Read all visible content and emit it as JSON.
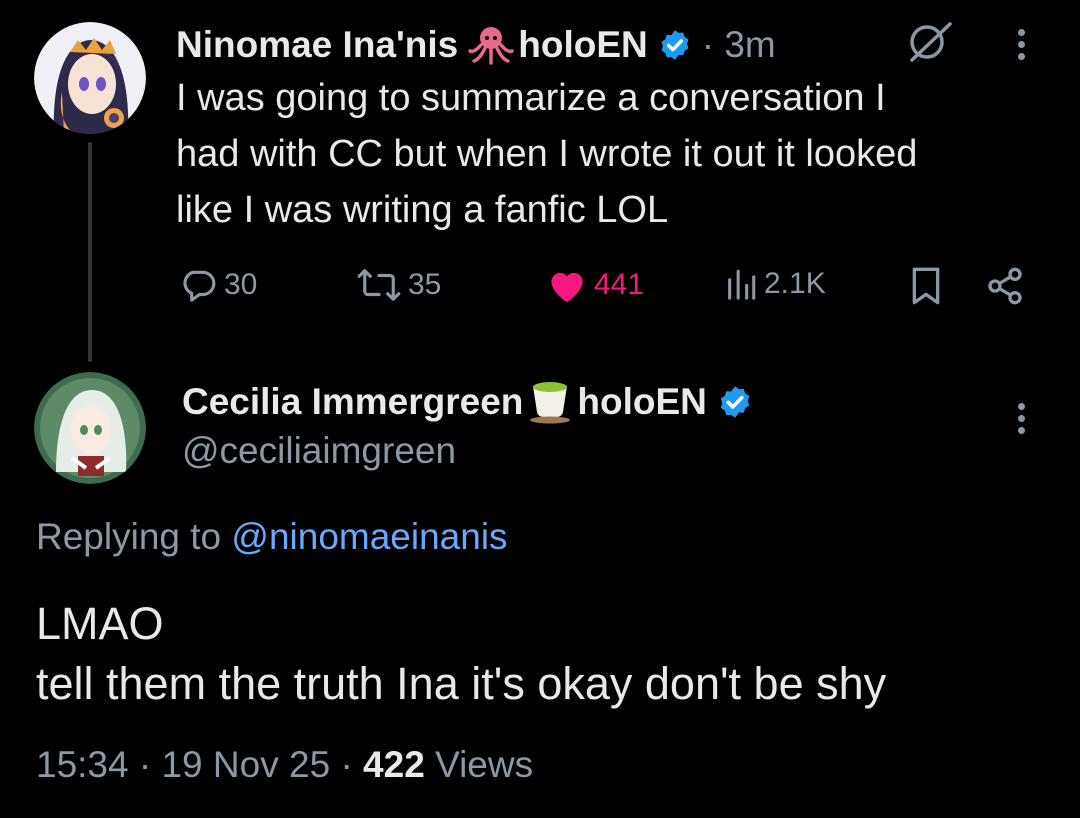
{
  "tweet1": {
    "display_name": "Ninomae Ina'nis",
    "name_suffix": "holoEN",
    "time": "· 3m",
    "text_lines": [
      "I was going to summarize a conversation I",
      "had with CC but when I wrote it out it looked",
      "like I was writing a fanfic LOL"
    ],
    "actions": {
      "replies": "30",
      "reposts": "35",
      "likes": "441",
      "views": "2.1K"
    },
    "icons": [
      "octopus-icon",
      "verified-icon",
      "grok-icon",
      "more-icon",
      "reply-icon",
      "repost-icon",
      "like-icon",
      "views-icon",
      "bookmark-icon",
      "share-icon"
    ]
  },
  "tweet2": {
    "display_name": "Cecilia Immergreen",
    "name_suffix": "holoEN",
    "handle": "@ceciliaimgreen",
    "replying_prefix": "Replying to",
    "replying_to": "@ninomaeinanis",
    "text_lines": [
      "LMAO",
      "tell them the truth Ina it's okay don't be shy"
    ],
    "meta": {
      "time": "15:34",
      "date": "19 Nov 25",
      "views_count": "422",
      "views_label": "Views"
    },
    "icons": [
      "tea-cup-icon",
      "verified-icon",
      "more-icon"
    ]
  },
  "colors": {
    "background": "#000000",
    "text": "#e7e9ea",
    "secondary": "#8b98a5",
    "like": "#f91880",
    "link": "#6aa8ff",
    "verified": "#1d9bf0"
  }
}
